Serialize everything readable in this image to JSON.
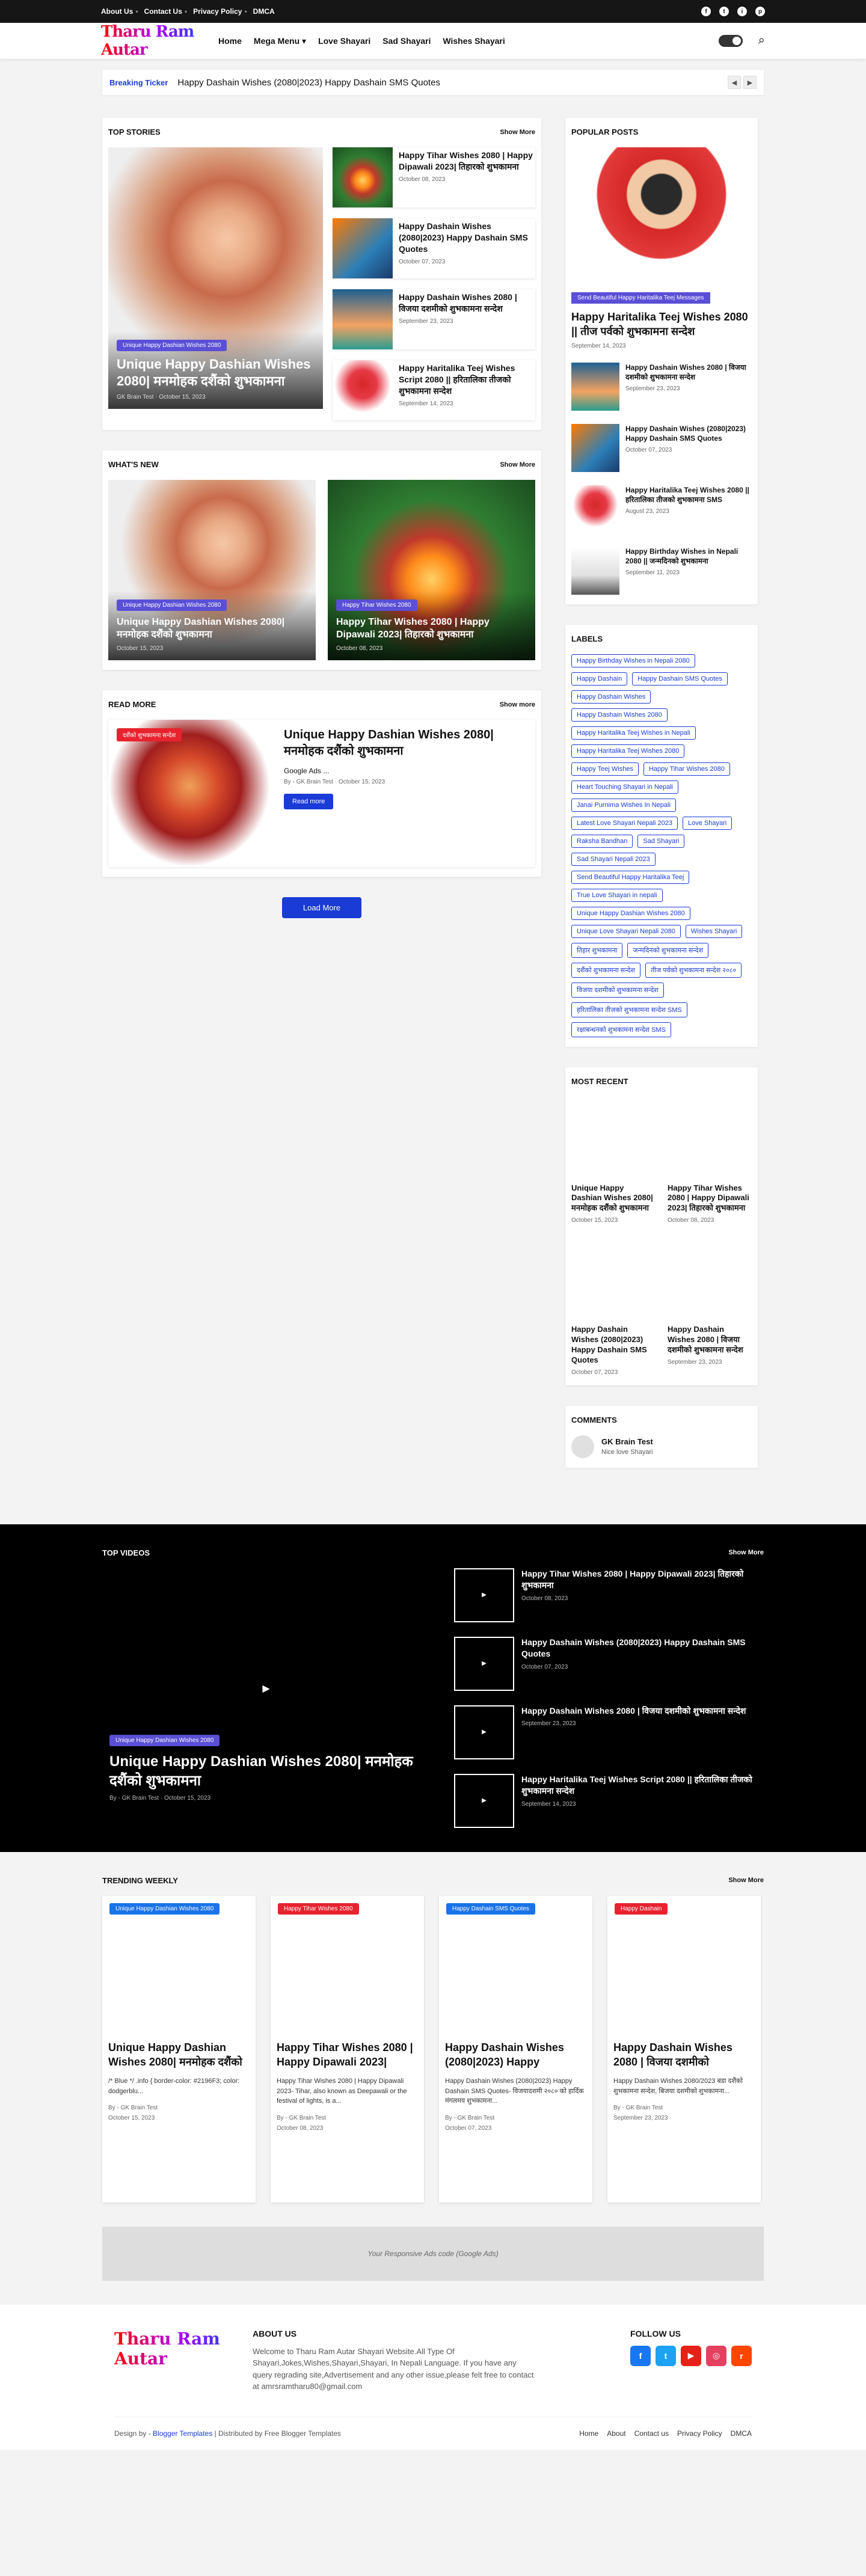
{
  "topbar": {
    "links": [
      "About Us",
      "Contact Us",
      "Privacy Policy",
      "DMCA"
    ],
    "social": [
      "f",
      "t",
      "i",
      "p"
    ]
  },
  "header": {
    "logo": "Tharu Ram Autar",
    "nav": [
      "Home",
      "Mega Menu ▾",
      "Love Shayari",
      "Sad Shayari",
      "Wishes Shayari"
    ]
  },
  "ticker": {
    "label": "Breaking Ticker",
    "text": "Happy Dashain Wishes (2080|2023) Happy Dashain SMS Quotes"
  },
  "top_stories": {
    "title": "TOP STORIES",
    "more": "Show More",
    "big": {
      "badge": "Unique Happy Dashian Wishes 2080",
      "title": "Unique Happy Dashian Wishes 2080| मनमोहक दशैंको शुभकामना",
      "author": "GK Brain Test",
      "date": "October 15, 2023"
    },
    "items": [
      {
        "title": "Happy Tihar Wishes 2080 | Happy Dipawali 2023| तिहारको शुभकामना",
        "date": "October 08, 2023"
      },
      {
        "title": "Happy Dashain Wishes (2080|2023) Happy Dashain SMS Quotes",
        "date": "October 07, 2023"
      },
      {
        "title": "Happy Dashain Wishes 2080 | विजया दशमीको शुभकामना सन्देश",
        "date": "September 23, 2023"
      },
      {
        "title": "Happy Haritalika Teej Wishes Script 2080 || हरितालिका तीजको शुभकामना सन्देश",
        "date": "September 14, 2023"
      }
    ]
  },
  "whats_new": {
    "title": "WHAT'S NEW",
    "more": "Show More",
    "items": [
      {
        "badge": "Unique Happy Dashian Wishes 2080",
        "title": "Unique Happy Dashian Wishes 2080| मनमोहक दशैंको शुभकामना",
        "date": "October 15, 2023"
      },
      {
        "badge": "Happy Tihar Wishes 2080",
        "title": "Happy Tihar Wishes 2080 | Happy Dipawali 2023| तिहारको शुभकामना",
        "date": "October 08, 2023"
      }
    ]
  },
  "read_more": {
    "title": "READ MORE",
    "more": "Show more",
    "badge": "दशैंको शुभकामना सन्देश",
    "post_title": "Unique Happy Dashian Wishes 2080| मनमोहक दशैंको शुभकामना",
    "excerpt": "Google Ads ...",
    "author": "GK Brain Test",
    "date": "October 15, 2023",
    "button": "Read more"
  },
  "load_more": "Load More",
  "popular": {
    "title": "POPULAR POSTS",
    "badge": "Send Beautiful Happy Haritalika Teej Messages",
    "big_title": "Happy Haritalika Teej Wishes 2080 || तीज पर्वको शुभकामना सन्देश",
    "big_date": "September 14, 2023",
    "items": [
      {
        "title": "Happy Dashain Wishes 2080 | विजया दशमीको शुभकामना सन्देश",
        "date": "September 23, 2023"
      },
      {
        "title": "Happy Dashain Wishes (2080|2023) Happy Dashain SMS Quotes",
        "date": "October 07, 2023"
      },
      {
        "title": "Happy Haritalika Teej Wishes 2080 || हरितालिका तीजको शुभकामना SMS",
        "date": "August 23, 2023"
      },
      {
        "title": "Happy Birthday Wishes in Nepali 2080 || जन्मदिनको शुभकामना",
        "date": "September 11, 2023"
      }
    ]
  },
  "labels": {
    "title": "LABELS",
    "items": [
      "Happy Birthday Wishes in Nepali 2080",
      "Happy Dashain",
      "Happy Dashain SMS Quotes",
      "Happy Dashain Wishes",
      "Happy Dashain Wishes 2080",
      "Happy Haritalika Teej Wishes in Nepali",
      "Happy Haritalika Teej Wishes 2080",
      "Happy Teej Wishes",
      "Happy Tihar Wishes 2080",
      "Heart Touching Shayari in Nepali",
      "Janai Purnima Wishes In Nepali",
      "Latest Love Shayari Nepali 2023",
      "Love Shayari",
      "Raksha Bandhan",
      "Sad Shayari",
      "Sad Shayari Nepali 2023",
      "Send Beautiful Happy Haritalika Teej",
      "True Love Shayari in nepali",
      "Unique Happy Dashian Wishes 2080",
      "Unique Love Shayari Nepali 2080",
      "Wishes Shayari",
      "तिहार शुभकामना",
      "जन्मदिनको शुभकामना सन्देश",
      "दशैंको शुभकामना सन्देश",
      "तीज पर्वको शुभकामना सन्देश २०८०",
      "विजया दशमीको शुभकामना सन्देश",
      "हरितालिका तीजको शुभकामना सन्देश SMS",
      "रक्षाबन्धनको शुभकामना सन्देश SMS"
    ]
  },
  "most_recent": {
    "title": "MOST RECENT",
    "items": [
      {
        "title": "Unique Happy Dashian Wishes 2080| मनमोहक दशैंको शुभकामना",
        "date": "October 15, 2023"
      },
      {
        "title": "Happy Tihar Wishes 2080 | Happy Dipawali 2023| तिहारको शुभकामना",
        "date": "October 08, 2023"
      },
      {
        "title": "Happy Dashain Wishes (2080|2023) Happy Dashain SMS Quotes",
        "date": "October 07, 2023"
      },
      {
        "title": "Happy Dashain Wishes 2080 | विजया दशमीको शुभकामना सन्देश",
        "date": "September 23, 2023"
      }
    ]
  },
  "comments": {
    "title": "COMMENTS",
    "name": "GK Brain Test",
    "text": "Nice love Shayari"
  },
  "videos": {
    "title": "TOP VIDEOS",
    "more": "Show More",
    "badge": "Unique Happy Dashian Wishes 2080",
    "main_title": "Unique Happy Dashian Wishes 2080| मनमोहक दशैंको शुभकामना",
    "author": "GK Brain Test",
    "date": "October 15, 2023",
    "items": [
      {
        "title": "Happy Tihar Wishes 2080 | Happy Dipawali 2023| तिहारको शुभकामना",
        "date": "October 08, 2023"
      },
      {
        "title": "Happy Dashain Wishes (2080|2023) Happy Dashain SMS Quotes",
        "date": "October 07, 2023"
      },
      {
        "title": "Happy Dashain Wishes 2080 | विजया दशमीको शुभकामना सन्देश",
        "date": "September 23, 2023"
      },
      {
        "title": "Happy Haritalika Teej Wishes Script 2080 || हरितालिका तीजको शुभकामना सन्देश",
        "date": "September 14, 2023"
      }
    ]
  },
  "trending": {
    "title": "TRENDING WEEKLY",
    "more": "Show More",
    "items": [
      {
        "badge": "Unique Happy Dashian Wishes 2080",
        "color": "#1a73e8",
        "title": "Unique Happy Dashian Wishes 2080| मनमोहक दशैंको",
        "excerpt": "/* Blue */ .info { border-color: #2196F3; color: dodgerblu...",
        "author": "GK Brain Test",
        "date": "October 15, 2023"
      },
      {
        "badge": "Happy Tihar Wishes 2080",
        "color": "#e8232f",
        "title": "Happy Tihar Wishes 2080 | Happy Dipawali 2023|",
        "excerpt": "Happy Tihar Wishes 2080 | Happy Dipawali 2023- Tihar, also known as Deepawali or the festival of lights, is a...",
        "author": "GK Brain Test",
        "date": "October 08, 2023"
      },
      {
        "badge": "Happy Dashain SMS Quotes",
        "color": "#1a73e8",
        "title": "Happy Dashain Wishes (2080|2023) Happy",
        "excerpt": "Happy Dashain Wishes (2080|2023) Happy Dashain SMS Quotes- विजयादशमी २०८० को हार्दिक मंगलमय शुभकामना...",
        "author": "GK Brain Test",
        "date": "October 07, 2023"
      },
      {
        "badge": "Happy Dashain",
        "color": "#e8232f",
        "title": "Happy Dashain Wishes 2080 | विजया दशमीको",
        "excerpt": "Happy Dashain Wishes 2080/2023 बडा दशैंको शुभकामना सन्देश, बिजया दशमीको शुभकामना...",
        "author": "GK Brain Test",
        "date": "September 23, 2023"
      }
    ]
  },
  "ads": "Your Responsive Ads code (Google Ads)",
  "footer": {
    "logo": "Tharu Ram Autar",
    "about_title": "ABOUT US",
    "about": "Welcome to Tharu Ram Autar Shayari Website.All Type Of Shayari,Jokes,Wishes,Shayari,Shayari, In Nepali Language. If you have any query regrading site,Advertisement and any other issue,please felt free to contact at amrsramtharu80@gmail.com",
    "follow_title": "FOLLOW US",
    "design": "Design by -",
    "blogger": "Blogger Templates",
    "dist": "| Distributed by Free Blogger Templates",
    "links": [
      "Home",
      "About",
      "Contact us",
      "Privacy Policy",
      "DMCA"
    ]
  }
}
